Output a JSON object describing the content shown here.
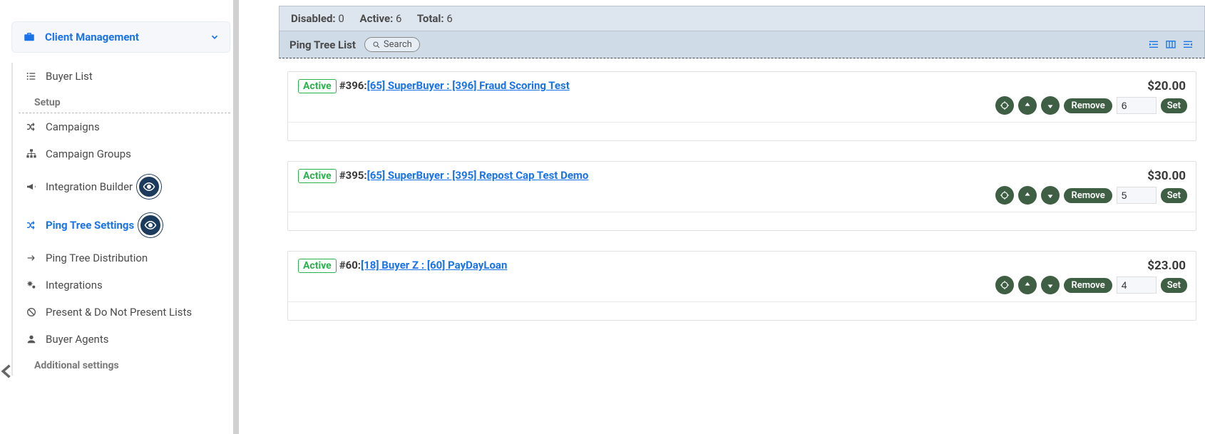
{
  "sidebar": {
    "header": "Client Management",
    "items": [
      {
        "label": "Buyer List",
        "icon": "list"
      },
      {
        "label": "Setup",
        "separator": true
      },
      {
        "label": "Campaigns",
        "icon": "shuffle"
      },
      {
        "label": "Campaign Groups",
        "icon": "sitemap"
      },
      {
        "label": "Integration Builder",
        "icon": "bullhorn",
        "eye": true
      },
      {
        "label": "Ping Tree Settings",
        "icon": "shuffle",
        "active": true,
        "eye": true
      },
      {
        "label": "Ping Tree Distribution",
        "icon": "arrow-right"
      },
      {
        "label": "Integrations",
        "icon": "cogs"
      },
      {
        "label": "Present & Do Not Present Lists",
        "icon": "ban"
      },
      {
        "label": "Buyer Agents",
        "icon": "user"
      },
      {
        "label": "Additional settings",
        "separator": true
      }
    ]
  },
  "status": {
    "disabled_label": "Disabled:",
    "disabled": "0",
    "active_label": "Active:",
    "active": "6",
    "total_label": "Total:",
    "total": "6"
  },
  "list_header": {
    "title": "Ping Tree List",
    "search_label": "Search"
  },
  "controls": {
    "remove_label": "Remove",
    "set_label": "Set"
  },
  "items": [
    {
      "status": "Active",
      "id_prefix": "#396: ",
      "link": "[65] SuperBuyer : [396] Fraud Scoring Test",
      "price": "$20.00",
      "order": "6"
    },
    {
      "status": "Active",
      "id_prefix": "#395: ",
      "link": "[65] SuperBuyer : [395] Repost Cap Test Demo",
      "price": "$30.00",
      "order": "5"
    },
    {
      "status": "Active",
      "id_prefix": "#60: ",
      "link": "[18] Buyer Z : [60] PayDayLoan",
      "price": "$23.00",
      "order": "4"
    }
  ]
}
